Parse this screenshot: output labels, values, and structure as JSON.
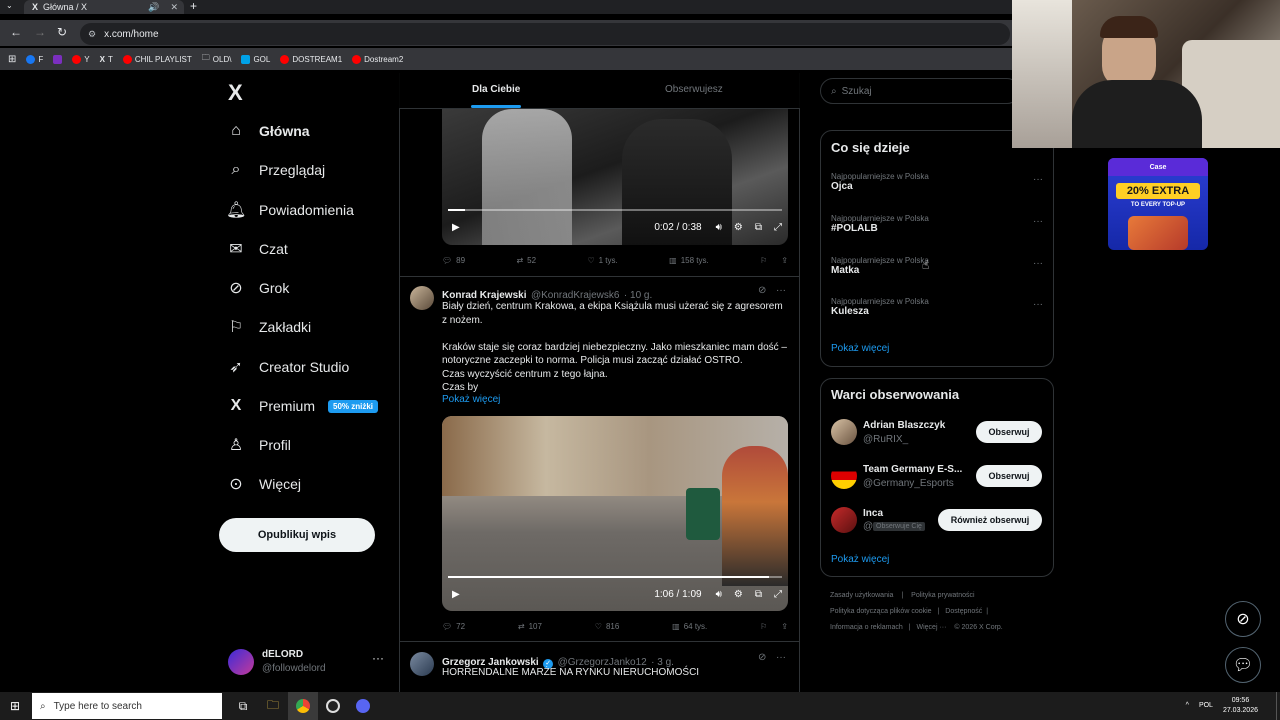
{
  "browser": {
    "tab_title": "Główna / X",
    "tab_x": "X",
    "url": "x.com/home",
    "bookmarks": [
      {
        "label": "F",
        "color": "#1877f2"
      },
      {
        "label": "",
        "color": "#7b2fbf"
      },
      {
        "label": "Y",
        "color": "#ff0000"
      },
      {
        "label": "T",
        "color": "#ffffff"
      },
      {
        "label": "CHIL PLAYLIST",
        "color": "#ff0000"
      },
      {
        "label": "OLD\\",
        "color": "folder"
      },
      {
        "label": "GOL",
        "color": "#00a2e8"
      },
      {
        "label": "DOSTREAM1",
        "color": "#ff0000"
      },
      {
        "label": "Dostream2",
        "color": "#ff0000"
      }
    ]
  },
  "sidebar": {
    "logo": "X",
    "items": [
      {
        "label": "Główna",
        "icon": "home-icon"
      },
      {
        "label": "Przeglądaj",
        "icon": "search-icon"
      },
      {
        "label": "Powiadomienia",
        "icon": "bell-icon"
      },
      {
        "label": "Czat",
        "icon": "mail-icon"
      },
      {
        "label": "Grok",
        "icon": "grok-icon"
      },
      {
        "label": "Zakładki",
        "icon": "bookmark-icon"
      },
      {
        "label": "Creator Studio",
        "icon": "rocket-icon"
      },
      {
        "label": "Premium",
        "icon": "x-icon",
        "badge": "50% zniżki"
      },
      {
        "label": "Profil",
        "icon": "person-icon"
      },
      {
        "label": "Więcej",
        "icon": "more-circle-icon"
      }
    ],
    "post_button": "Opublikuj wpis",
    "account": {
      "name": "dELORD",
      "handle": "@followdelord"
    }
  },
  "feed": {
    "tabs": [
      "Dla Ciebie",
      "Obserwujesz"
    ],
    "tweet1": {
      "video_time": "0:02 / 0:38",
      "video_progress": 0.05,
      "replies": "89",
      "reposts": "52",
      "likes": "1 tys.",
      "views": "158 tys."
    },
    "tweet2": {
      "name": "Konrad Krajewski",
      "handle": "@KonradKrajewsk6",
      "time": "· 10 g.",
      "text": "Biały dzień, centrum Krakowa, a ekipa Książula musi użerać się z agresorem z nożem.\n\nKraków staje się coraz bardziej niebezpieczny. Jako mieszkaniec mam dość – notoryczne zaczepki to norma. Policja musi zacząć działać OSTRO.\nCzas wyczyścić centrum z tego łajna.\nCzas by",
      "show_more": "Pokaż więcej",
      "video_time": "1:06 / 1:09",
      "video_progress": 0.96,
      "replies": "72",
      "reposts": "107",
      "likes": "816",
      "views": "64 tys."
    },
    "tweet3": {
      "name": "Grzegorz Jankowski",
      "handle": "@GrzegorzJanko12",
      "time": "· 3 g.",
      "text": "HORRENDALNE MARŻE NA RYNKU NIERUCHOMOŚCI"
    }
  },
  "right": {
    "search_placeholder": "Szukaj",
    "trends_title": "Co się dzieje",
    "trends": [
      {
        "context": "Najpopularniejsze w Polska",
        "name": "Ojca"
      },
      {
        "context": "Najpopularniejsze w Polska",
        "name": "#POLALB"
      },
      {
        "context": "Najpopularniejsze w Polska",
        "name": "Matka"
      },
      {
        "context": "Najpopularniejsze w Polska",
        "name": "Kulesza"
      }
    ],
    "trends_more": "Pokaż więcej",
    "wtf_title": "Warci obserwowania",
    "wtf": [
      {
        "name": "Adrian Blaszczyk",
        "handle": "@RuRIX_",
        "button": "Obserwuj",
        "badge": ""
      },
      {
        "name": "Team Germany E-S...",
        "handle": "@Germany_Esports",
        "button": "Obserwuj",
        "badge": ""
      },
      {
        "name": "Inca",
        "handle": "@",
        "button": "Również obserwuj",
        "badge": "Obserwuje Cię"
      }
    ],
    "wtf_more": "Pokaż więcej",
    "footer": [
      "Zasady użytkowania",
      "|",
      "Polityka prywatności",
      "|",
      "Polityka dotycząca plików cookie",
      "|",
      "Dostępność",
      "|",
      "Informacja o reklamach",
      "|",
      "Więcej ···",
      "© 2026 X Corp."
    ]
  },
  "ad": {
    "brand": "Case",
    "headline": "20% EXTRA",
    "sub": "TO EVERY TOP-UP"
  },
  "taskbar": {
    "search_placeholder": "Type here to search",
    "lang": "POL",
    "time": "09:56",
    "date": "27.03.2026"
  }
}
